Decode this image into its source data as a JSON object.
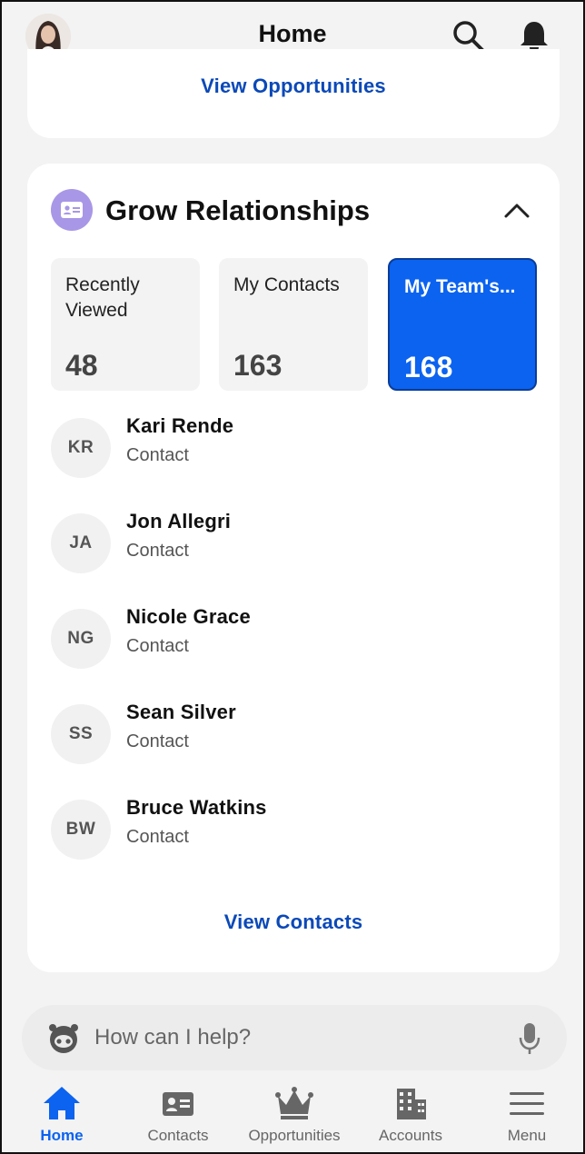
{
  "header": {
    "title": "Home"
  },
  "top_card": {
    "link_label": "View Opportunities"
  },
  "section": {
    "title": "Grow Relationships",
    "tiles": [
      {
        "label": "Recently Viewed",
        "count": "48"
      },
      {
        "label": "My Contacts",
        "count": "163"
      },
      {
        "label": "My Team's...",
        "count": "168",
        "selected": true
      }
    ],
    "contacts": [
      {
        "initials": "KR",
        "name": "Kari Rende",
        "type": "Contact"
      },
      {
        "initials": "JA",
        "name": "Jon Allegri",
        "type": "Contact"
      },
      {
        "initials": "NG",
        "name": "Nicole Grace",
        "type": "Contact"
      },
      {
        "initials": "SS",
        "name": "Sean Silver",
        "type": "Contact"
      },
      {
        "initials": "BW",
        "name": "Bruce Watkins",
        "type": "Contact"
      }
    ],
    "view_link": "View Contacts"
  },
  "assistant": {
    "placeholder": "How can I help?"
  },
  "nav": {
    "items": [
      {
        "label": "Home",
        "icon": "home-icon",
        "active": true
      },
      {
        "label": "Contacts",
        "icon": "contact-card-icon"
      },
      {
        "label": "Opportunities",
        "icon": "crown-icon"
      },
      {
        "label": "Accounts",
        "icon": "building-icon"
      },
      {
        "label": "Menu",
        "icon": "hamburger-menu-icon"
      }
    ]
  },
  "colors": {
    "accent": "#0b63f0",
    "link": "#0b49b8",
    "section_icon_bg": "#a897e6",
    "background": "#f3f3f3"
  }
}
